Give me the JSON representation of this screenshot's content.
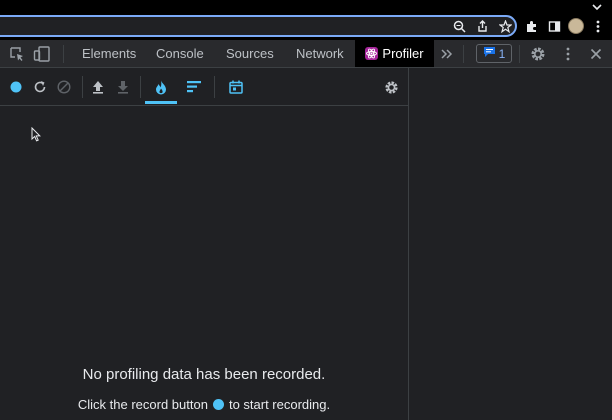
{
  "browser": {
    "icons": [
      "zoom-icon",
      "share-icon",
      "star-icon",
      "extensions-icon",
      "side-panel-icon",
      "avatar",
      "more-icon",
      "chevron-down-icon"
    ]
  },
  "devtools": {
    "tabs": [
      {
        "label": "Elements"
      },
      {
        "label": "Console"
      },
      {
        "label": "Sources"
      },
      {
        "label": "Network"
      },
      {
        "label": "Profiler",
        "active": true
      }
    ],
    "issues_count": "1"
  },
  "profiler": {
    "empty_title": "No profiling data has been recorded.",
    "hint_before": "Click the record button",
    "hint_after": "to start recording."
  },
  "colors": {
    "accent": "#4fc3f7",
    "background": "#202124",
    "react_badge": "#a5259a"
  }
}
